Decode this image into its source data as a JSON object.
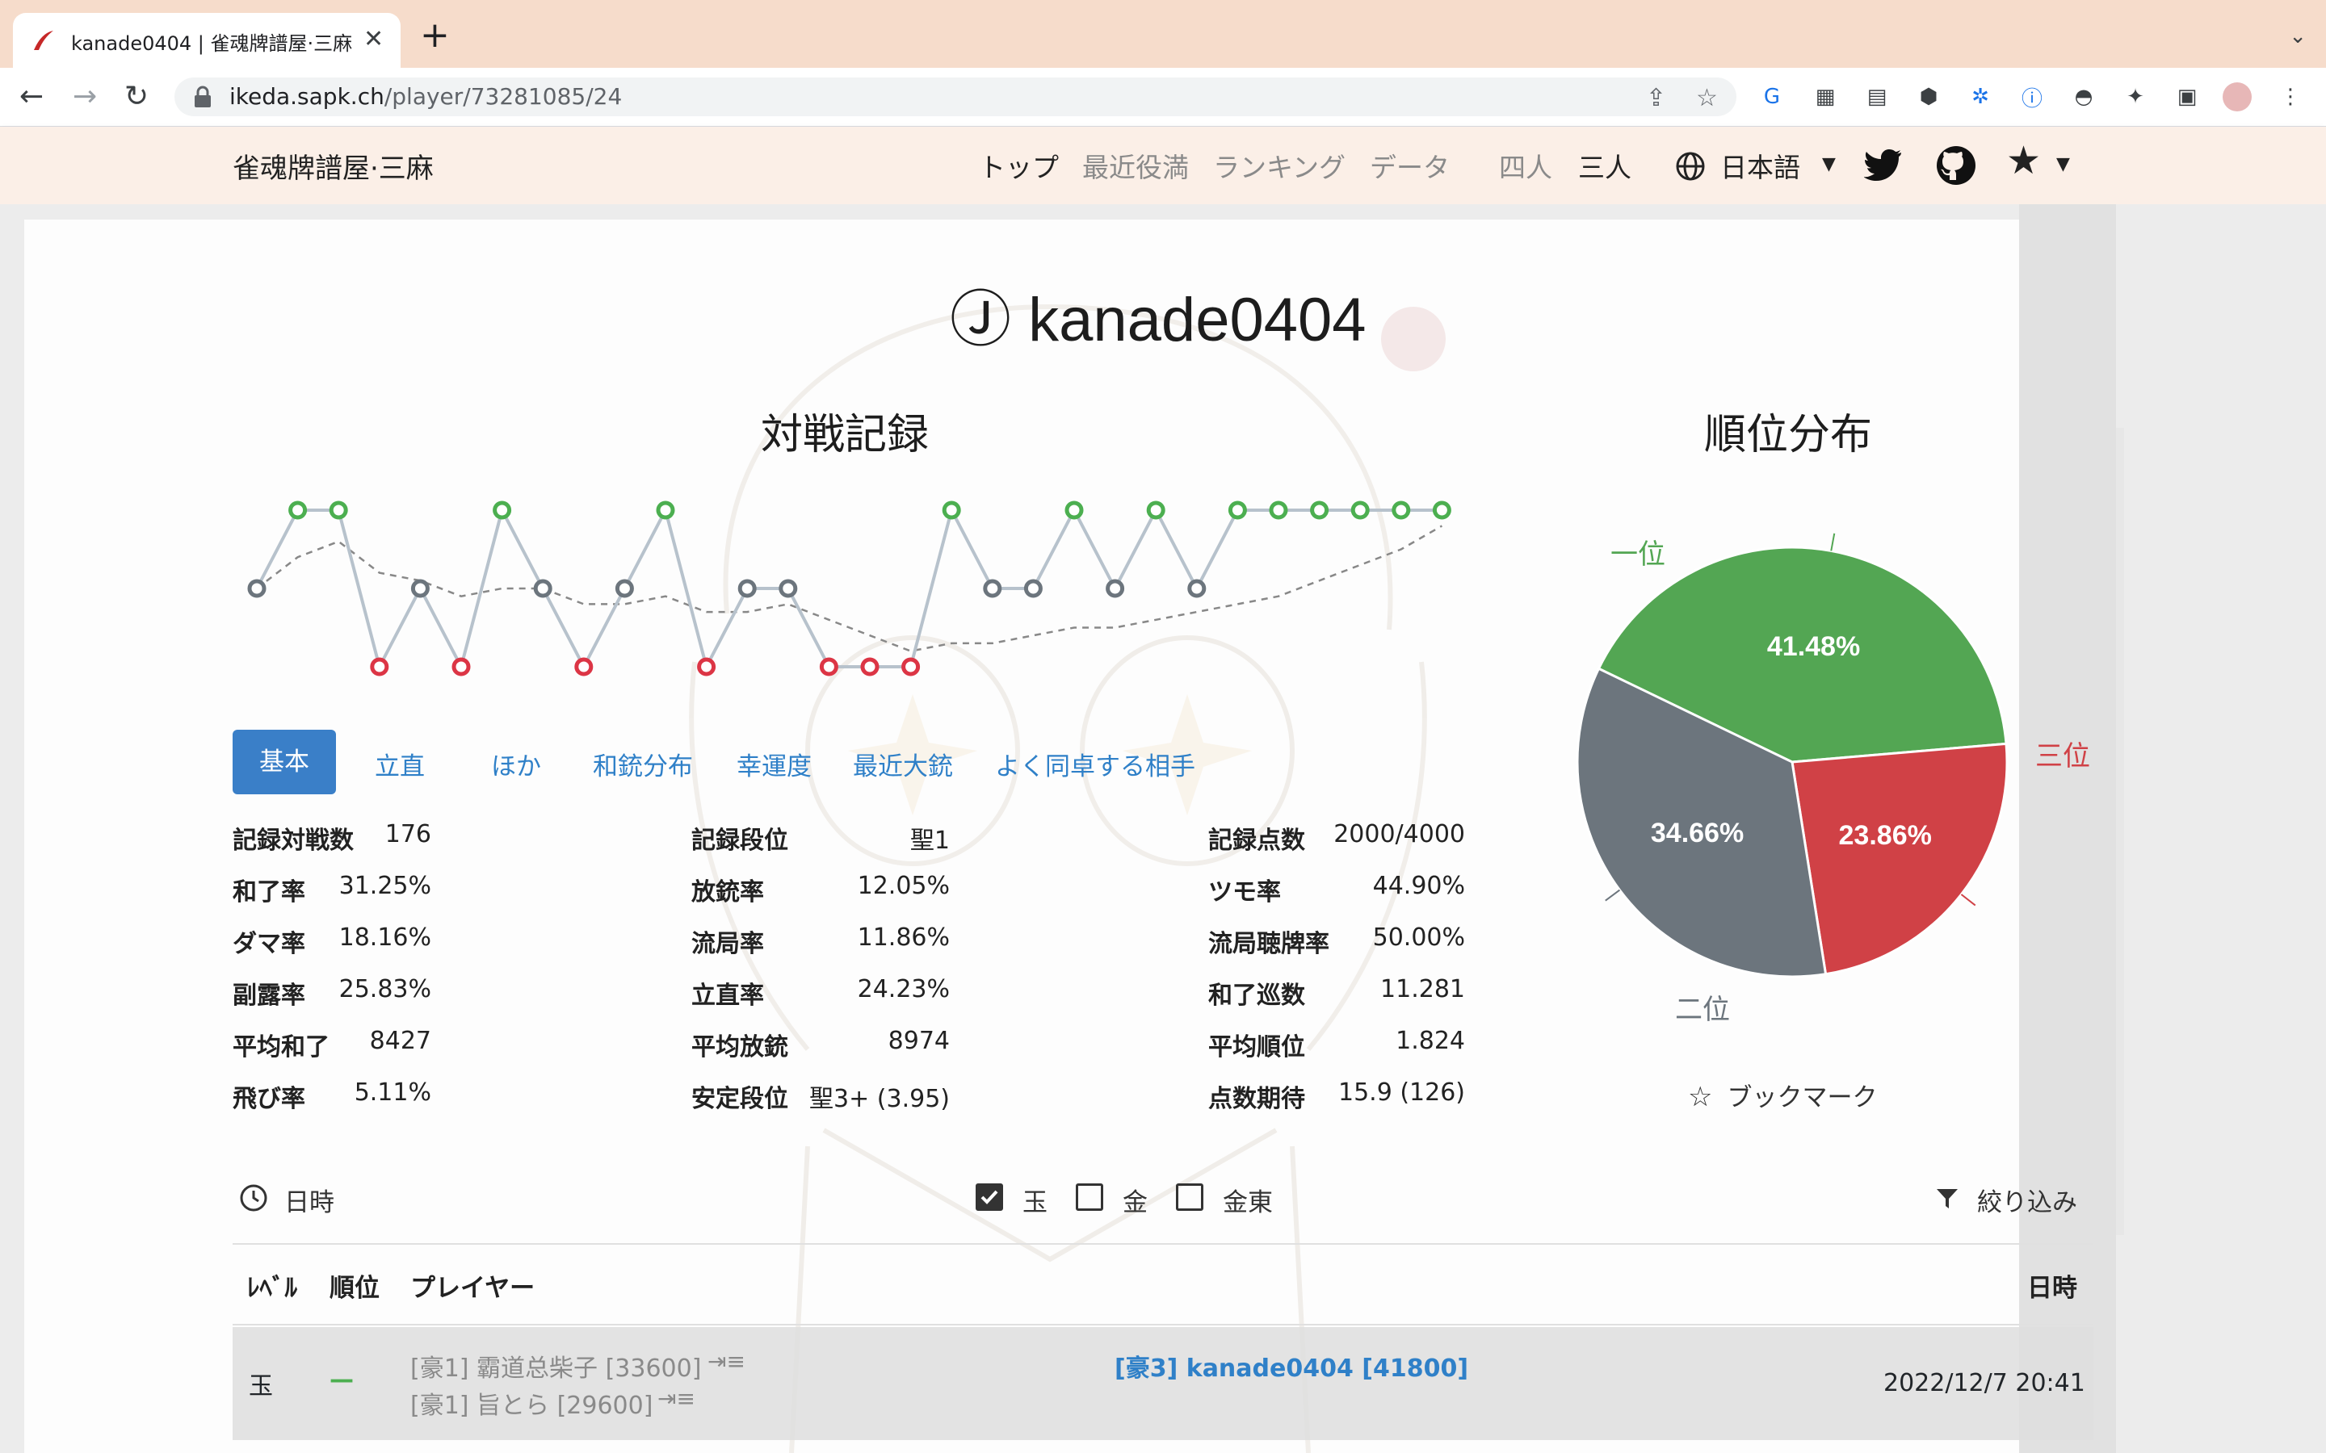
{
  "browser": {
    "tab_title": "kanade0404 | 雀魂牌譜屋·三麻",
    "url_host": "ikeda.sapk.ch",
    "url_path": "/player/73281085/24"
  },
  "site": {
    "brand": "雀魂牌譜屋·三麻",
    "nav": [
      "トップ",
      "最近役満",
      "ランキング",
      "データ",
      "四人",
      "三人"
    ],
    "language": "日本語"
  },
  "player": {
    "badge": "Ⓙ",
    "name": "kanade0404"
  },
  "record_title": "対戦記録",
  "rank_title": "順位分布",
  "tabs": [
    "基本",
    "立直",
    "ほか",
    "和銃分布",
    "幸運度",
    "最近大銃",
    "よく同卓する相手"
  ],
  "stats": {
    "col1": [
      {
        "label": "記録対戦数",
        "value": "176"
      },
      {
        "label": "和了率",
        "value": "31.25%"
      },
      {
        "label": "ダマ率",
        "value": "18.16%"
      },
      {
        "label": "副露率",
        "value": "25.83%"
      },
      {
        "label": "平均和了",
        "value": "8427"
      },
      {
        "label": "飛び率",
        "value": "5.11%"
      }
    ],
    "col2": [
      {
        "label": "記録段位",
        "value": "聖1"
      },
      {
        "label": "放銃率",
        "value": "12.05%"
      },
      {
        "label": "流局率",
        "value": "11.86%"
      },
      {
        "label": "立直率",
        "value": "24.23%"
      },
      {
        "label": "平均放銃",
        "value": "8974"
      },
      {
        "label": "安定段位",
        "value": "聖3+ (3.95)"
      }
    ],
    "col3": [
      {
        "label": "記録点数",
        "value": "2000/4000"
      },
      {
        "label": "ツモ率",
        "value": "44.90%"
      },
      {
        "label": "流局聴牌率",
        "value": "50.00%"
      },
      {
        "label": "和了巡数",
        "value": "11.281"
      },
      {
        "label": "平均順位",
        "value": "1.824"
      },
      {
        "label": "点数期待",
        "value": "15.9 (126)"
      }
    ]
  },
  "bookmark_label": "ブックマーク",
  "filter": {
    "date_label": "日時",
    "options": [
      {
        "label": "玉",
        "checked": true
      },
      {
        "label": "金",
        "checked": false
      },
      {
        "label": "金東",
        "checked": false
      }
    ],
    "narrow_label": "絞り込み"
  },
  "table": {
    "headers": {
      "level": "ﾚﾍﾞﾙ",
      "rank": "順位",
      "players": "プレイヤー",
      "date": "日時"
    },
    "rows": [
      {
        "level": "玉",
        "rank": "—",
        "opponents": [
          "[豪1] 霸道总柴子 [33600]",
          "[豪1] 旨とら [29600]"
        ],
        "self": "[豪3] kanade0404 [41800]",
        "date": "2022/12/7 20:41"
      }
    ]
  },
  "chart_data": [
    {
      "type": "line",
      "title": "対戦記録",
      "y_meaning": "placement (1 = top)",
      "ylim": [
        3,
        1
      ],
      "series": [
        {
          "values": [
            2,
            1,
            1,
            3,
            2,
            3,
            1,
            2,
            3,
            2,
            1,
            3,
            2,
            2,
            3,
            3,
            3,
            1,
            2,
            2,
            1,
            2,
            1,
            2,
            1,
            1,
            1,
            1,
            1,
            1
          ]
        },
        {
          "style": "dashed",
          "values": [
            2,
            1.6,
            1.4,
            1.8,
            1.9,
            2.1,
            2.0,
            2.0,
            2.2,
            2.2,
            2.1,
            2.3,
            2.3,
            2.2,
            2.4,
            2.6,
            2.8,
            2.7,
            2.7,
            2.6,
            2.5,
            2.5,
            2.4,
            2.3,
            2.2,
            2.1,
            1.9,
            1.7,
            1.5,
            1.2
          ]
        }
      ],
      "colors": {
        "1": "#4caf50",
        "2": "#6c757d",
        "3": "#dc3545",
        "line": "#b7c2cc",
        "avg": "#888888"
      }
    },
    {
      "type": "pie",
      "title": "順位分布",
      "slices": [
        {
          "label": "一位",
          "value": 41.48,
          "text": "41.48%",
          "color": "#53a653"
        },
        {
          "label": "三位",
          "value": 23.86,
          "text": "23.86%",
          "color": "#d04146"
        },
        {
          "label": "二位",
          "value": 34.66,
          "text": "34.66%",
          "color": "#6c757d"
        }
      ]
    }
  ]
}
